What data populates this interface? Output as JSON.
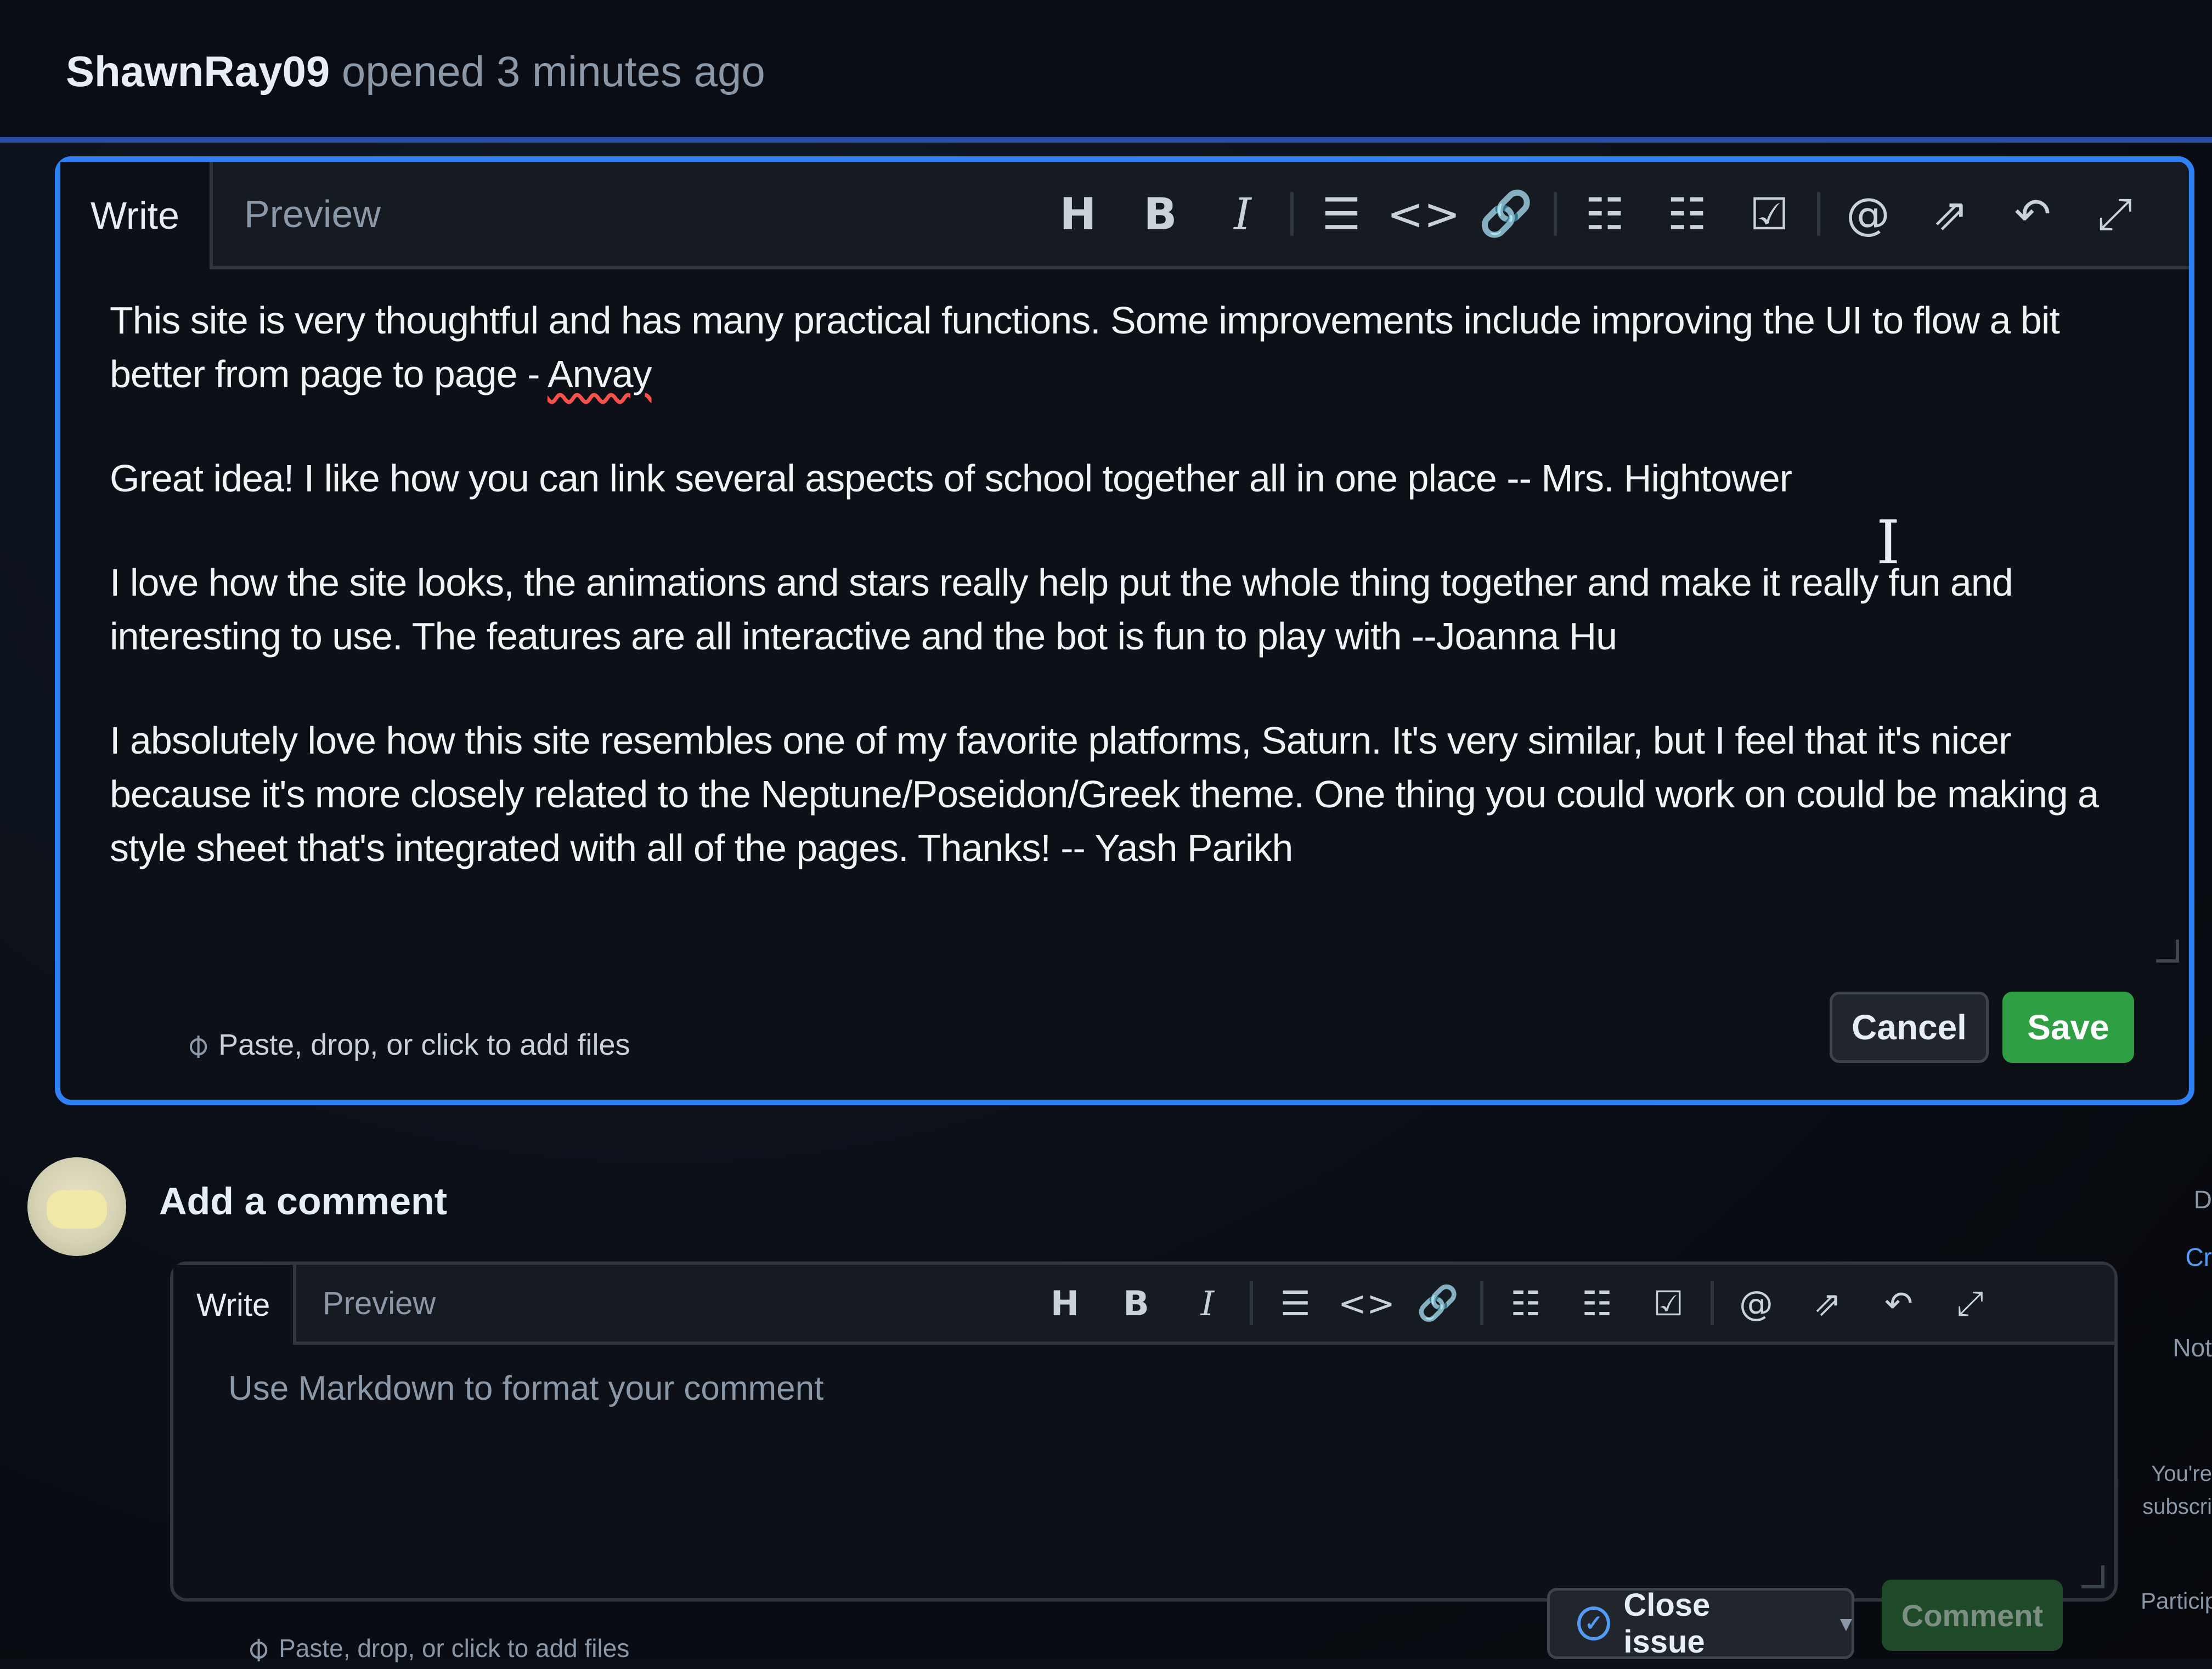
{
  "header": {
    "author": "ShawnRay09",
    "opened_text": "opened 3 minutes ago"
  },
  "edit_editor": {
    "tabs": [
      "Write",
      "Preview"
    ],
    "toolbar": [
      {
        "icon": "heading-icon",
        "glyph": "H"
      },
      {
        "icon": "bold-icon",
        "glyph": "B"
      },
      {
        "icon": "italic-icon",
        "glyph": "I"
      },
      {
        "icon": "quote-icon",
        "glyph": "☰"
      },
      {
        "icon": "code-icon",
        "glyph": "<>"
      },
      {
        "icon": "link-icon",
        "glyph": "🔗"
      },
      {
        "icon": "unordered-list-icon",
        "glyph": "☷"
      },
      {
        "icon": "ordered-list-icon",
        "glyph": "☷"
      },
      {
        "icon": "task-list-icon",
        "glyph": "☑"
      },
      {
        "icon": "mention-icon",
        "glyph": "@"
      },
      {
        "icon": "cross-reference-icon",
        "glyph": "⇗"
      },
      {
        "icon": "reply-icon",
        "glyph": "↶"
      },
      {
        "icon": "fullscreen-icon",
        "glyph": "⤢"
      }
    ],
    "paragraphs": {
      "p1_text": "This site is very thoughtful and has many practical functions. Some improvements include improving the UI to flow a bit better from page to page - ",
      "p1_name": "Anvay",
      "p2": "Great idea! I like how you can link several aspects of school together all in one place -- Mrs. Hightower",
      "p3": "I love how the site looks, the animations and stars really help put the whole thing together and make it really fun and interesting to use. The features are all interactive and the bot is fun to play with --Joanna Hu",
      "p4": "I absolutely love how this site resembles one of my favorite platforms, Saturn. It's very similar, but I feel that it's nicer because it's more closely related to the Neptune/Poseidon/Greek theme. One thing you could work on could be making a style sheet that's integrated with all of the pages. Thanks! -- Yash Parikh"
    },
    "file_hint": "Paste, drop, or click to add files",
    "cancel_label": "Cancel",
    "save_label": "Save"
  },
  "new_comment": {
    "heading": "Add a comment",
    "tabs": [
      "Write",
      "Preview"
    ],
    "placeholder": "Use Markdown to format your comment",
    "file_hint": "Paste, drop, or click to add files",
    "close_issue_label": "Close issue",
    "comment_label": "Comment"
  },
  "sidebar_fragments": [
    "D",
    "Cr",
    "Not",
    "You're",
    "subscri",
    "Particip"
  ],
  "colors": {
    "accent_blue": "#2f81f7",
    "save_green": "#2ea043",
    "background": "#0d1117"
  }
}
